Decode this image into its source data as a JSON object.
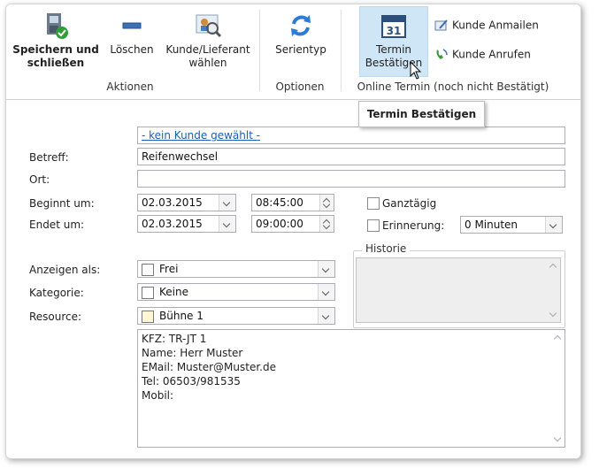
{
  "ribbon": {
    "save_close": "Speichern und schließen",
    "delete": "Löschen",
    "choose_customer": "Kunde/Lieferant wählen",
    "series_type": "Serientyp",
    "confirm_appointment": "Termin Bestätigen",
    "email_customer": "Kunde Anmailen",
    "call_customer": "Kunde Anrufen",
    "groups": {
      "actions": "Aktionen",
      "options": "Optionen",
      "online": "Online Termin (noch nicht Bestätigt)"
    }
  },
  "tooltip": "Termin Bestätigen",
  "form": {
    "customer_link": "- kein Kunde gewählt -",
    "subject_label": "Betreff:",
    "subject_value": "Reifenwechsel",
    "location_label": "Ort:",
    "location_value": "",
    "start_label": "Beginnt um:",
    "start_date": "02.03.2015",
    "start_time": "08:45:00",
    "end_label": "Endet um:",
    "end_date": "02.03.2015",
    "end_time": "09:00:00",
    "all_day_label": "Ganztägig",
    "all_day_checked": false,
    "reminder_label": "Erinnerung:",
    "reminder_checked": false,
    "reminder_value": "0 Minuten",
    "history_label": "Historie",
    "show_as_label": "Anzeigen als:",
    "show_as_value": "Frei",
    "category_label": "Kategorie:",
    "category_value": "Keine",
    "resource_label": "Resource:",
    "resource_value": "Bühne 1",
    "resource_color": "#fff6d6",
    "notes": [
      "KFZ: TR-JT 1",
      "Name: Herr Muster",
      "EMail: Muster@Muster.de",
      "Tel: 06503/981535",
      "Mobil:"
    ]
  }
}
